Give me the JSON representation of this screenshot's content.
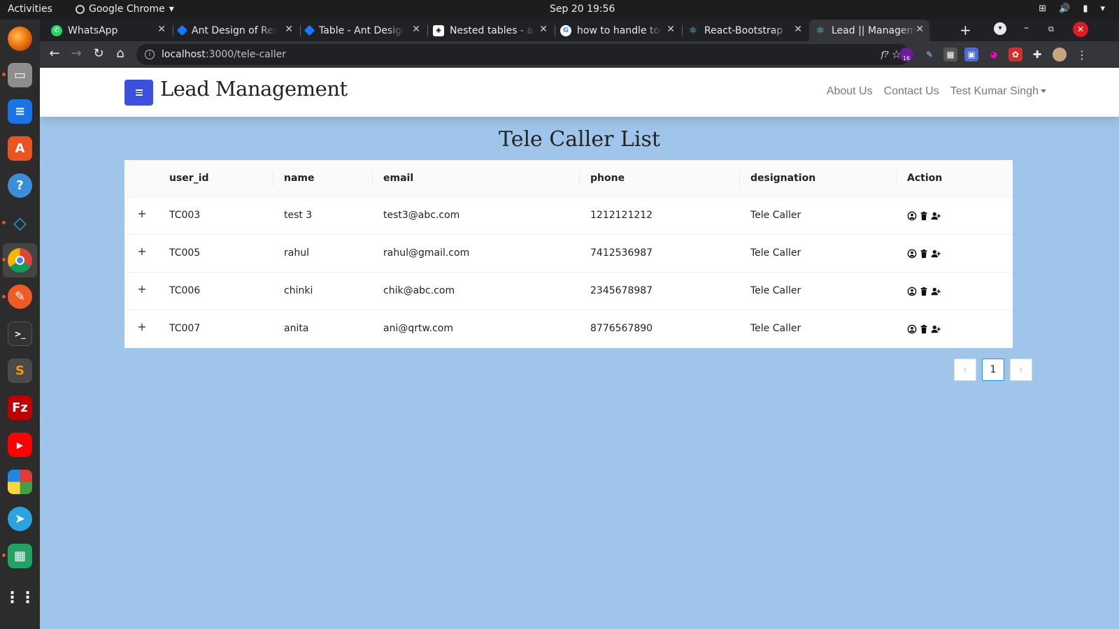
{
  "system": {
    "activities": "Activities",
    "app_name": "Google Chrome",
    "clock": "Sep 20  19:56"
  },
  "browser": {
    "tabs": [
      {
        "label": "WhatsApp",
        "color": "#25d366"
      },
      {
        "label": "Ant Design of Rea",
        "color": "#1677ff"
      },
      {
        "label": "Table - Ant Design",
        "color": "#1677ff"
      },
      {
        "label": "Nested tables - an",
        "color": "#ffffff"
      },
      {
        "label": "how to handle tog",
        "color": "#4285f4"
      },
      {
        "label": "React-Bootstrap",
        "color": "#61dafb"
      },
      {
        "label": "Lead || Manageme",
        "color": "#61dafb"
      }
    ],
    "active_tab_index": 6,
    "url_host": "localhost",
    "url_path": ":3000/tele-caller",
    "ext_badge": "16"
  },
  "dock": {
    "items": [
      "firefox-icon",
      "files-icon",
      "writer-icon",
      "software-icon",
      "help-icon",
      "vscode-icon",
      "chrome-icon",
      "postman-icon",
      "terminal-icon",
      "sublime-icon",
      "filezilla-icon",
      "youtube-icon",
      "apps-icon",
      "telegram-icon",
      "calc-icon",
      "grid-icon"
    ]
  },
  "navbar": {
    "brand": "Lead Management",
    "about": "About Us",
    "contact": "Contact Us",
    "user": "Test Kumar Singh"
  },
  "page": {
    "title": "Tele Caller List"
  },
  "table": {
    "headers": [
      "user_id",
      "name",
      "email",
      "phone",
      "designation",
      "Action"
    ],
    "rows": [
      {
        "user_id": "TC003",
        "name": "test 3",
        "email": "test3@abc.com",
        "phone": "1212121212",
        "designation": "Tele Caller"
      },
      {
        "user_id": "TC005",
        "name": "rahul",
        "email": "rahul@gmail.com",
        "phone": "7412536987",
        "designation": "Tele Caller"
      },
      {
        "user_id": "TC006",
        "name": "chinki",
        "email": "chik@abc.com",
        "phone": "2345678987",
        "designation": "Tele Caller"
      },
      {
        "user_id": "TC007",
        "name": "anita",
        "email": "ani@qrtw.com",
        "phone": "8776567890",
        "designation": "Tele Caller"
      }
    ]
  },
  "pagination": {
    "prev": "‹",
    "current": "1",
    "next": "›"
  }
}
